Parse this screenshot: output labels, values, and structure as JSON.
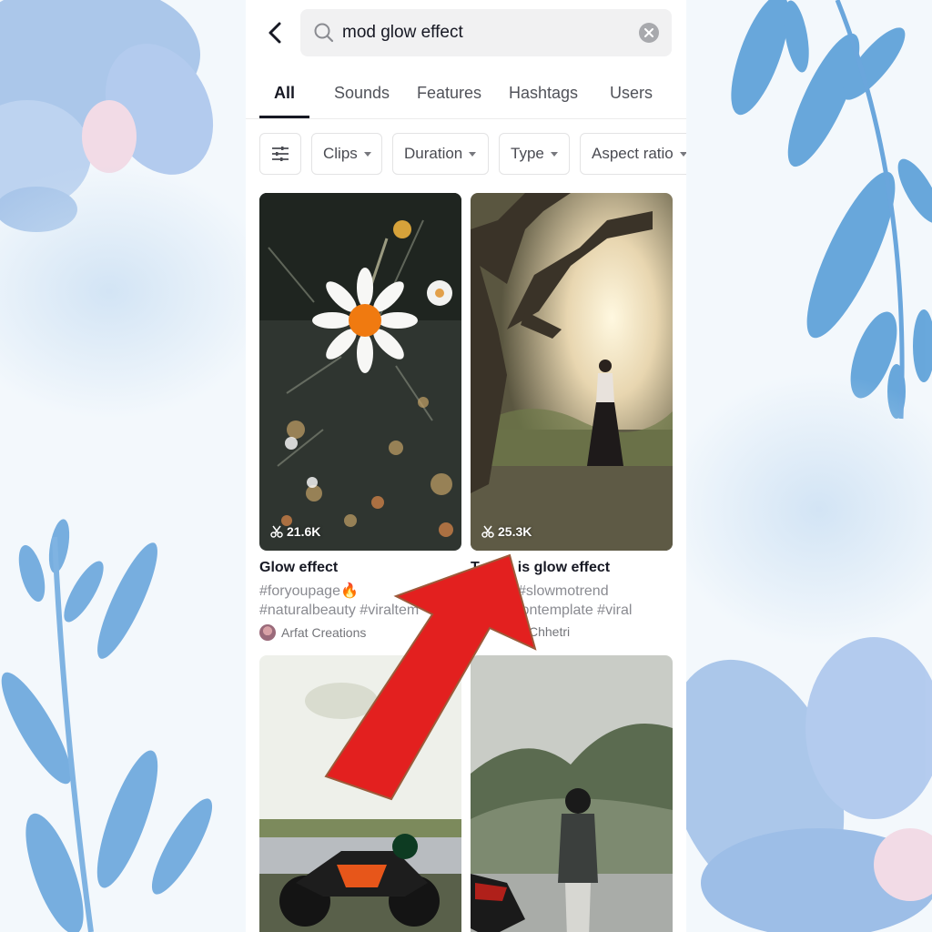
{
  "search": {
    "value": "mod glow effect",
    "back_icon": "chevron-left-icon",
    "search_icon": "search-icon",
    "clear_icon": "close-icon"
  },
  "tabs": [
    {
      "label": "All",
      "active": true
    },
    {
      "label": "Sounds"
    },
    {
      "label": "Features"
    },
    {
      "label": "Hashtags"
    },
    {
      "label": "Users"
    }
  ],
  "filters": {
    "settings_icon": "sliders-icon",
    "chips": [
      "Clips",
      "Duration",
      "Type",
      "Aspect ratio"
    ]
  },
  "results": [
    {
      "count": "21.6K",
      "title": "Glow effect",
      "desc_line1": "#foryoupage🔥",
      "desc_line2": "#naturalbeauty #viraltem",
      "author": "Arfat Creations"
    },
    {
      "count": "25.3K",
      "title": "T",
      "title_rest": "is glow effect",
      "desc_line1": "#slowmotrend",
      "desc_line2": "iontemplate #viral",
      "author": "Chhetri"
    }
  ],
  "colors": {
    "accent_text": "#161823",
    "arrow_red": "#e3201f"
  }
}
